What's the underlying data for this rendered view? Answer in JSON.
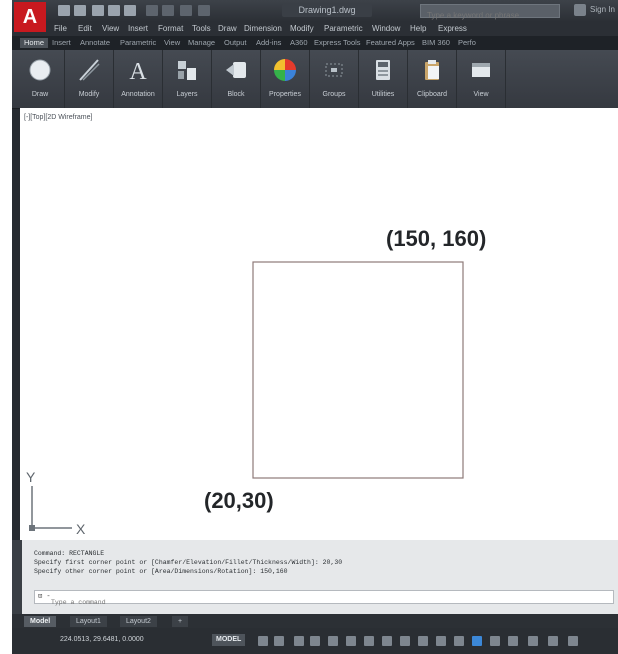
{
  "app": {
    "title": "Drawing1.dwg",
    "search_placeholder": "Type a keyword or phrase",
    "sign_in": "Sign In",
    "logo": "A",
    "brand_color": "#c8191f"
  },
  "menubar": [
    "File",
    "Edit",
    "View",
    "Insert",
    "Format",
    "Tools",
    "Draw",
    "Dimension",
    "Modify",
    "Parametric",
    "Window",
    "Help",
    "Express"
  ],
  "ribbon_tabs": [
    "Home",
    "Insert",
    "Annotate",
    "Parametric",
    "View",
    "Manage",
    "Output",
    "Add-ins",
    "A360",
    "Express Tools",
    "Featured Apps",
    "BIM 360",
    "Perfo"
  ],
  "active_tab": "Home",
  "ribbon_panels": [
    {
      "label": "Draw",
      "icon": "draw-circle-icon"
    },
    {
      "label": "Modify",
      "icon": "modify-icon"
    },
    {
      "label": "Annotation",
      "icon": "annotation-icon"
    },
    {
      "label": "Layers",
      "icon": "layers-icon"
    },
    {
      "label": "Block",
      "icon": "block-icon"
    },
    {
      "label": "Properties",
      "icon": "properties-icon"
    },
    {
      "label": "Groups",
      "icon": "groups-icon"
    },
    {
      "label": "Utilities",
      "icon": "utilities-icon"
    },
    {
      "label": "Clipboard",
      "icon": "clipboard-icon"
    },
    {
      "label": "View",
      "icon": "view-icon"
    }
  ],
  "viewport": {
    "label": "[-][Top][2D Wireframe]"
  },
  "drawing": {
    "corner_top_right": "(150, 160)",
    "corner_bottom_left": "(20,30)",
    "ucs_x": "X",
    "ucs_y": "Y"
  },
  "command": {
    "history": [
      "Command: RECTANGLE",
      "Specify first corner point or [Chamfer/Elevation/Fillet/Thickness/Width]: 20,30",
      "Specify other corner point or [Area/Dimensions/Rotation]: 150,160"
    ],
    "placeholder": "Type a command",
    "prompt": "⊡ -"
  },
  "layout_tabs": [
    "Model",
    "Layout1",
    "Layout2",
    "+"
  ],
  "status": {
    "coordinates": "224.0513, 29.6481, 0.0000",
    "model": "MODEL"
  }
}
